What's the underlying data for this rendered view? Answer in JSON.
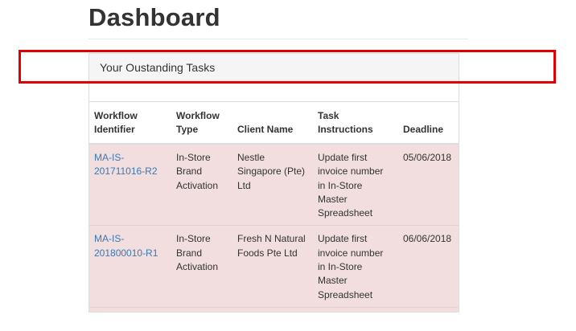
{
  "page": {
    "title": "Dashboard"
  },
  "panel": {
    "heading": "Your Oustanding Tasks"
  },
  "table": {
    "columns": [
      {
        "l1": "Workflow",
        "l2": "Identifier"
      },
      {
        "l1": "Workflow",
        "l2": "Type"
      },
      {
        "l1": "",
        "l2": "Client Name"
      },
      {
        "l1": "Task",
        "l2": "Instructions"
      },
      {
        "l1": "",
        "l2": "Deadline"
      }
    ],
    "rows": [
      {
        "id_l1": "MA-IS-",
        "id_l2": "201711016-R2",
        "type_l1": "In-Store",
        "type_l2": "Brand",
        "type_l3": "Activation",
        "client_l1": "Nestle",
        "client_l2": "Singapore (Pte)",
        "client_l3": "Ltd",
        "task_l1": "Update first",
        "task_l2": "invoice number",
        "task_l3": "in In-Store",
        "task_l4": "Master",
        "task_l5": "Spreadsheet",
        "deadline": "05/06/2018"
      },
      {
        "id_l1": "MA-IS-",
        "id_l2": "201800010-R1",
        "type_l1": "In-Store",
        "type_l2": "Brand",
        "type_l3": "Activation",
        "client_l1": "Fresh N Natural",
        "client_l2": "Foods Pte Ltd",
        "client_l3": "",
        "task_l1": "Update first",
        "task_l2": "invoice number",
        "task_l3": "in In-Store",
        "task_l4": "Master",
        "task_l5": "Spreadsheet",
        "deadline": "06/06/2018"
      }
    ]
  },
  "colors": {
    "highlight": "#e00000",
    "row_danger": "#f2dede",
    "link": "#3879b6"
  }
}
